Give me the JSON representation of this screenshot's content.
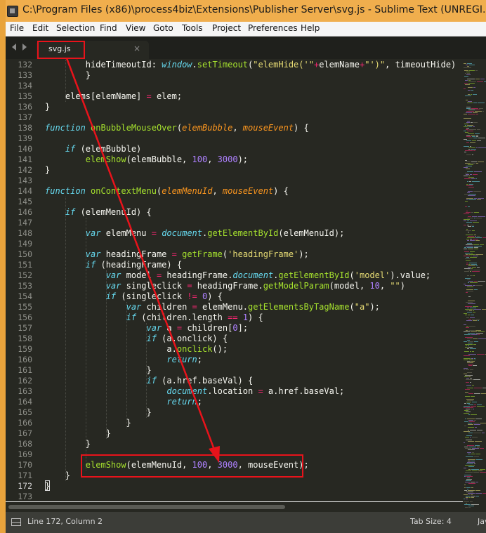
{
  "window": {
    "title": "C:\\Program Files (x86)\\process4biz\\Extensions\\Publisher Server\\svg.js - Sublime Text (UNREGI..."
  },
  "menu": [
    "File",
    "Edit",
    "Selection",
    "Find",
    "View",
    "Goto",
    "Tools",
    "Project",
    "Preferences",
    "Help"
  ],
  "tab": {
    "label": "svg.js",
    "close": "×"
  },
  "line_numbers": [
    "132",
    "133",
    "134",
    "135",
    "136",
    "137",
    "138",
    "139",
    "140",
    "141",
    "142",
    "143",
    "144",
    "145",
    "146",
    "147",
    "148",
    "149",
    "150",
    "151",
    "152",
    "153",
    "154",
    "155",
    "156",
    "157",
    "158",
    "159",
    "160",
    "161",
    "162",
    "163",
    "164",
    "165",
    "166",
    "167",
    "168",
    "169",
    "170",
    "171",
    "172",
    "173"
  ],
  "current_line": "172",
  "code_lines": [
    "        hideTimeoutId: window.setTimeout(\"elemHide('\"+elemName+\"')\", timeoutHide)",
    "        }",
    "",
    "    elems[elemName] = elem;",
    "}",
    "",
    "function onBubbleMouseOver(elemBubble, mouseEvent) {",
    "",
    "    if (elemBubble)",
    "        elemShow(elemBubble, 100, 3000);",
    "}",
    "",
    "function onContextMenu(elemMenuId, mouseEvent) {",
    "",
    "    if (elemMenuId) {",
    "",
    "        var elemMenu = document.getElementById(elemMenuId);",
    "",
    "        var headingFrame = getFrame('headingFrame');",
    "        if (headingFrame) {",
    "            var model = headingFrame.document.getElementById('model').value;",
    "            var singleclick = headingFrame.getModelParam(model, 10, \"\")",
    "            if (singleclick != 0) {",
    "                var children = elemMenu.getElementsByTagName(\"a\");",
    "                if (children.length == 1) {",
    "                    var a = children[0];",
    "                    if (a.onclick) {",
    "                        a.onclick();",
    "                        return;",
    "                    }",
    "                    if (a.href.baseVal) {",
    "                        document.location = a.href.baseVal;",
    "                        return;",
    "                    }",
    "                }",
    "            }",
    "        }",
    "",
    "        elemShow(elemMenuId, 100, 3000, mouseEvent);",
    "    }",
    "}",
    ""
  ],
  "status": {
    "position": "Line 172, Column 2",
    "tab_size": "Tab Size: 4",
    "syntax": "Jav"
  },
  "colors": {
    "editor_bg": "#272822",
    "keyword": "#66d9ef",
    "function": "#a6e22e",
    "string": "#e6db74",
    "number": "#ae81ff",
    "operator": "#f92672",
    "parameter": "#fd971f",
    "annotation": "#e8131b"
  },
  "icons": {
    "app": "sublime-text-icon",
    "nav_left": "chevron-left-icon",
    "nav_right": "chevron-right-icon",
    "status_panel": "panel-toggle-icon"
  }
}
